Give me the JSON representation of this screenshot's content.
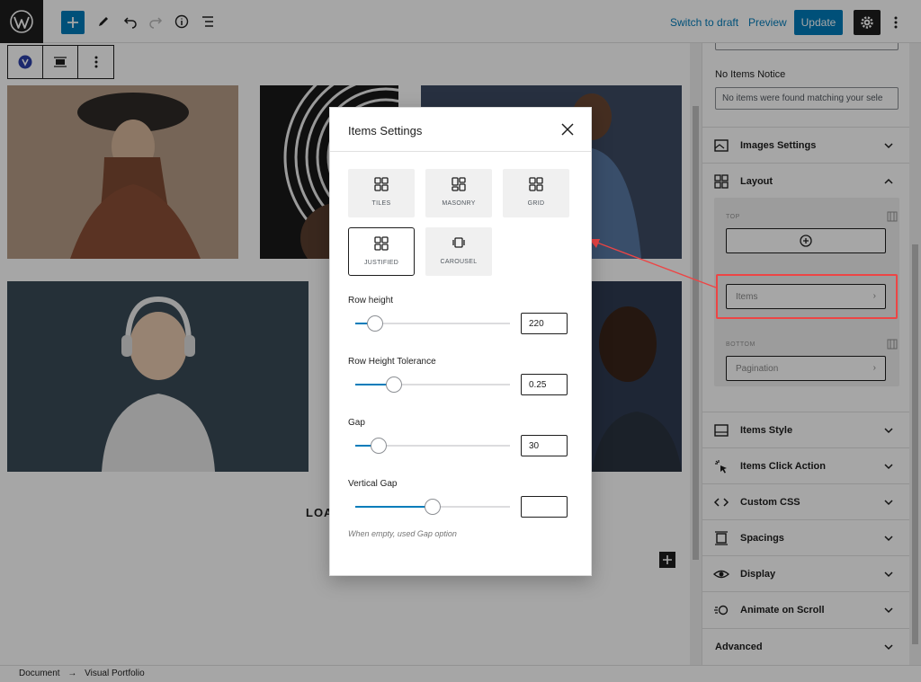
{
  "topbar": {
    "switch_to_draft": "Switch to draft",
    "preview": "Preview",
    "update": "Update"
  },
  "canvas": {
    "load_more_partial": "LOA"
  },
  "sidebar": {
    "no_items_notice_label": "No Items Notice",
    "no_items_notice_value": "No items were found matching your sele",
    "panels": {
      "images_settings": "Images Settings",
      "layout": "Layout",
      "items_style": "Items Style",
      "items_click_action": "Items Click Action",
      "custom_css": "Custom CSS",
      "spacings": "Spacings",
      "display": "Display",
      "animate_on_scroll": "Animate on Scroll",
      "advanced": "Advanced"
    },
    "layout_box": {
      "top_caption": "TOP",
      "items_label": "Items",
      "bottom_caption": "BOTTOM",
      "pagination_label": "Pagination"
    }
  },
  "modal": {
    "title": "Items Settings",
    "layouts": [
      {
        "label": "TILES"
      },
      {
        "label": "MASONRY"
      },
      {
        "label": "GRID"
      },
      {
        "label": "JUSTIFIED"
      },
      {
        "label": "CAROUSEL"
      }
    ],
    "selected_layout": "JUSTIFIED",
    "row_height": {
      "label": "Row height",
      "value": "220",
      "fraction": 0.13
    },
    "row_height_tolerance": {
      "label": "Row Height Tolerance",
      "value": "0.25",
      "fraction": 0.25
    },
    "gap": {
      "label": "Gap",
      "value": "30",
      "fraction": 0.15
    },
    "vertical_gap": {
      "label": "Vertical Gap",
      "value": "",
      "fraction": 0.5
    },
    "help_text": "When empty, used Gap option"
  },
  "footer": {
    "breadcrumb_root": "Document",
    "breadcrumb_sep": "→",
    "breadcrumb_current": "Visual Portfolio"
  },
  "colors": {
    "accent": "#007cba",
    "highlight": "#ed4545"
  }
}
